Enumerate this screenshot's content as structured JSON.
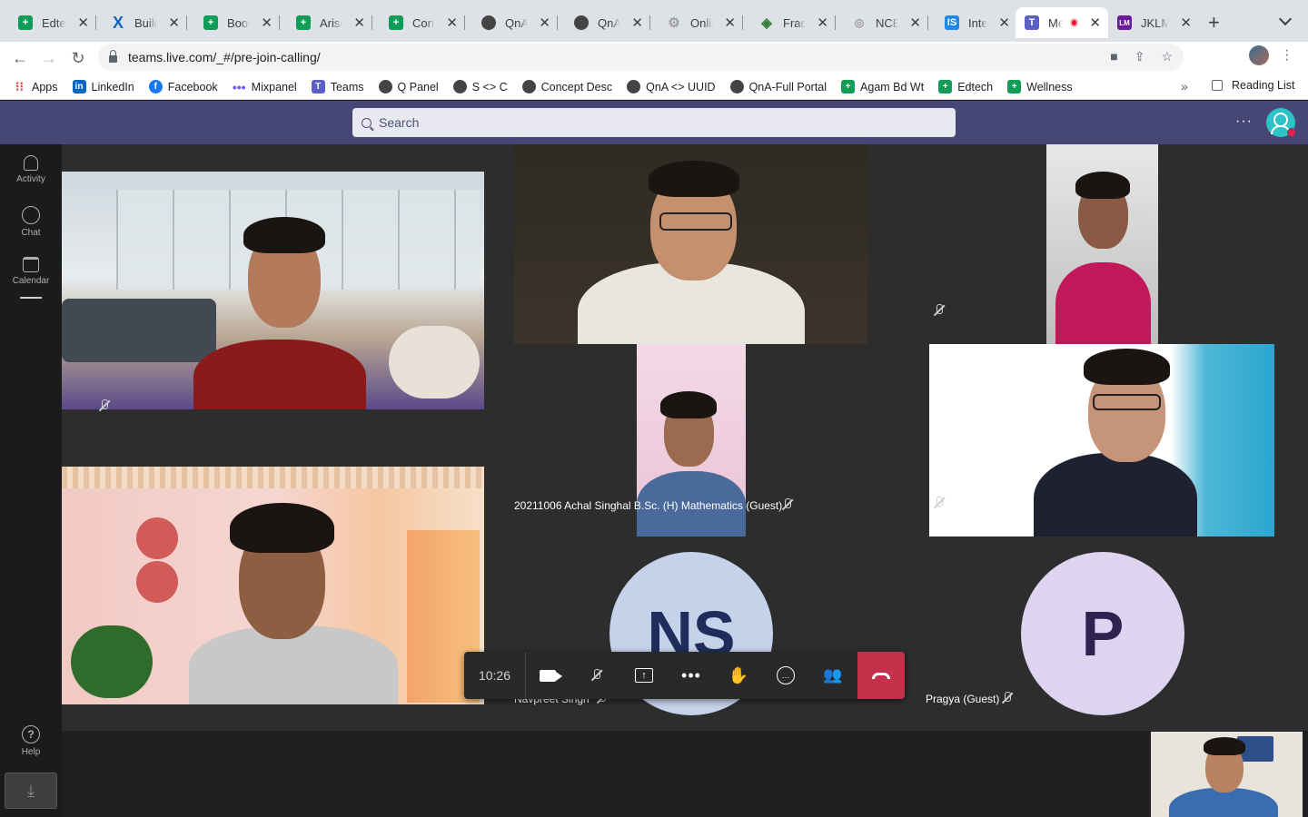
{
  "browser": {
    "tabs": [
      {
        "label": "Edtech",
        "icon": "sheets-icon",
        "color": "#0f9d58"
      },
      {
        "label": "Building",
        "icon": "x-icon",
        "color": "#1565c0"
      },
      {
        "label": "Book-",
        "icon": "sheets-icon",
        "color": "#0f9d58"
      },
      {
        "label": "Arise -",
        "icon": "sheets-icon",
        "color": "#0f9d58"
      },
      {
        "label": "Conce",
        "icon": "sheets-icon",
        "color": "#0f9d58"
      },
      {
        "label": "QnA-F",
        "icon": "globe-icon",
        "color": "#444444"
      },
      {
        "label": "QnA P",
        "icon": "globe-icon",
        "color": "#444444"
      },
      {
        "label": "Online",
        "icon": "gear-icon",
        "color": "#9e9e9e"
      },
      {
        "label": "Fractic",
        "icon": "diamond-icon",
        "color": "#2e7d32"
      },
      {
        "label": "NCER",
        "icon": "circle-icon",
        "color": "#9e9e9e"
      },
      {
        "label": "Intern",
        "icon": "is-icon",
        "color": "#1e88e5"
      },
      {
        "label": "Me",
        "icon": "teams-icon",
        "color": "#5b5fc7",
        "active": true,
        "recording": true
      },
      {
        "label": "JKLM",
        "icon": "jklm-icon",
        "color": "#6a1b9a"
      }
    ],
    "new_tab": "+",
    "url": "teams.live.com/_#/pre-join-calling/",
    "bookmarks": [
      {
        "label": "Apps",
        "icon": "apps-grid-icon"
      },
      {
        "label": "LinkedIn",
        "icon": "linkedin-icon"
      },
      {
        "label": "Facebook",
        "icon": "facebook-icon"
      },
      {
        "label": "Mixpanel",
        "icon": "mixpanel-icon"
      },
      {
        "label": "Teams",
        "icon": "teams-icon"
      },
      {
        "label": "Q Panel",
        "icon": "globe-icon"
      },
      {
        "label": "S <> C",
        "icon": "globe-icon"
      },
      {
        "label": "Concept Desc",
        "icon": "globe-icon"
      },
      {
        "label": "QnA <> UUID",
        "icon": "globe-icon"
      },
      {
        "label": "QnA-Full Portal",
        "icon": "globe-icon"
      },
      {
        "label": "Agam Bd Wt",
        "icon": "sheets-icon"
      },
      {
        "label": "Edtech",
        "icon": "sheets-icon"
      },
      {
        "label": "Wellness",
        "icon": "sheets-icon"
      }
    ],
    "bookmarks_more": "»",
    "reading_list": "Reading List"
  },
  "teams": {
    "search_placeholder": "Search",
    "more": "···",
    "rail": [
      {
        "label": "Activity",
        "icon": "bell-icon"
      },
      {
        "label": "Chat",
        "icon": "chat-icon"
      },
      {
        "label": "Calendar",
        "icon": "calendar-icon"
      }
    ],
    "help": "Help",
    "help_glyph": "?",
    "download_glyph": "⤓"
  },
  "call": {
    "timer": "10:26",
    "participants": [
      {
        "name": "20211006 Achal Singhal B.Sc. (H) Mathematics (Guest)",
        "muted": true
      },
      {
        "name": "Navpreet Singh",
        "initials": "NS",
        "muted": true,
        "avatar_bg": "#c5d3ea",
        "initials_color": "#1f2d5c"
      },
      {
        "name": "Pragya (Guest)",
        "initials": "P",
        "muted": true,
        "avatar_bg": "#ddd4f0",
        "initials_color": "#2f2251"
      }
    ],
    "controls": [
      "camera-icon",
      "mic-off-icon",
      "share-screen-icon",
      "more-actions-icon",
      "raise-hand-icon",
      "chat-icon",
      "participants-icon",
      "hang-up-icon"
    ],
    "hangup_color": "#c4314b"
  }
}
